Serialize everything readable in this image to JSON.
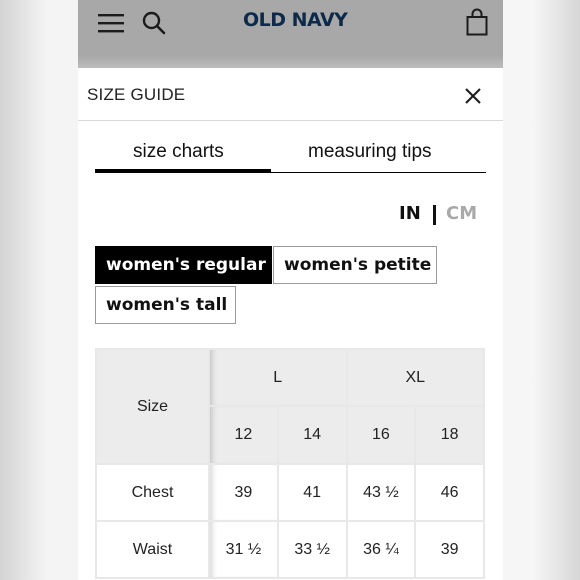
{
  "header": {
    "logo": "OLD NAVY",
    "icons": [
      "hamburger-menu-icon",
      "search-icon",
      "shopping-bag-icon"
    ]
  },
  "modal": {
    "title": "SIZE GUIDE",
    "close_icon": "close-icon"
  },
  "tabs": [
    {
      "label": "size charts",
      "active": true
    },
    {
      "label": "measuring tips",
      "active": false
    }
  ],
  "units": {
    "options": [
      "IN",
      "CM"
    ],
    "selected": "IN",
    "active_color": "#111111",
    "inactive_color": "#a9a9a9"
  },
  "fits": [
    {
      "label": "women's regular",
      "selected": true
    },
    {
      "label": "women's petite",
      "selected": false
    },
    {
      "label": "women's tall",
      "selected": false
    }
  ],
  "size_table": {
    "size_label": "Size",
    "groups": [
      "L",
      "XL"
    ],
    "sizes": [
      "12",
      "14",
      "16",
      "18"
    ],
    "rows": [
      {
        "label": "Chest",
        "values": [
          "39",
          "41",
          "43 ½",
          "46"
        ]
      },
      {
        "label": "Waist",
        "values": [
          "31 ½",
          "33 ½",
          "36 ¼",
          "39"
        ]
      }
    ]
  },
  "colors": {
    "brand_navy": "#0e2a4a",
    "selected_fill": "#000000",
    "header_gray": "#a8a8a8",
    "table_header_bg": "#ececec"
  }
}
